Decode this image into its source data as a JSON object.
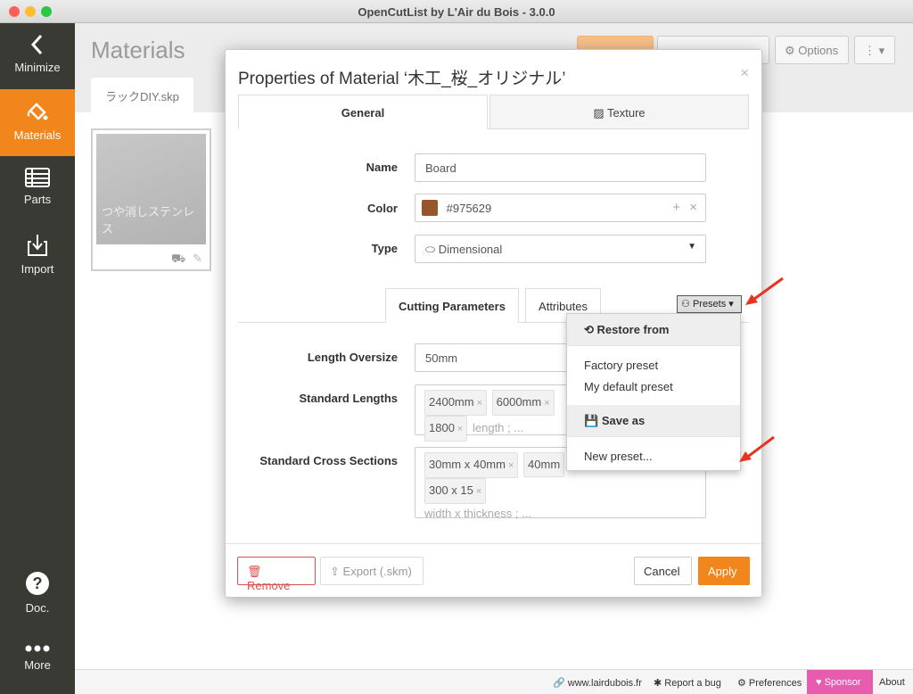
{
  "window": {
    "title": "OpenCutList by L'Air du Bois - 3.0.0"
  },
  "sidebar": {
    "items": [
      {
        "label": "Minimize",
        "icon": "chevron-left-icon"
      },
      {
        "label": "Materials",
        "icon": "paint-bucket-icon"
      },
      {
        "label": "Parts",
        "icon": "list-icon"
      },
      {
        "label": "Import",
        "icon": "import-icon"
      },
      {
        "label": "Doc.",
        "icon": "help-icon"
      },
      {
        "label": "More",
        "icon": "more-icon"
      }
    ]
  },
  "main": {
    "title": "Materials",
    "file_tab": "ラックDIY.skp",
    "options_label": "Options",
    "material_card": {
      "name": "つや消しステンレス"
    }
  },
  "dialog": {
    "title": "Properties of Material ‘木工_桜_オリジナル’",
    "close": "×",
    "tabs": [
      {
        "label": "General"
      },
      {
        "label": "Texture"
      }
    ],
    "fields": {
      "name_label": "Name",
      "name_value": "Board",
      "color_label": "Color",
      "color_value": "#975629",
      "type_label": "Type",
      "type_value": "Dimensional"
    },
    "sub_tabs": [
      {
        "label": "Cutting Parameters"
      },
      {
        "label": "Attributes"
      }
    ],
    "presets_label": "Presets",
    "length_oversize_label": "Length Oversize",
    "length_oversize_value": "50mm",
    "standard_lengths_label": "Standard Lengths",
    "standard_lengths": [
      "2400mm",
      "6000mm",
      "1800"
    ],
    "standard_lengths_placeholder": "length ; ...",
    "cross_sections_label": "Standard Cross Sections",
    "cross_sections": [
      "30mm x 40mm",
      "40mm",
      "300 x 15"
    ],
    "cross_sections_placeholder": "width x thickness ; ...",
    "buttons": {
      "remove": "Remove",
      "export": "Export (.skm)",
      "cancel": "Cancel",
      "apply": "Apply"
    }
  },
  "presets_menu": {
    "restore_header": "Restore from",
    "factory": "Factory preset",
    "my_default": "My default preset",
    "save_header": "Save as",
    "new_preset": "New preset..."
  },
  "footer": {
    "site": "www.lairdubois.fr",
    "bug": "Report a bug",
    "preferences": "Preferences",
    "sponsor": "Sponsor",
    "about": "About"
  },
  "colors": {
    "accent": "#f0861c",
    "sidebar": "#3a3a34",
    "sponsor": "#e85cb0",
    "remove": "#d9534f",
    "arrow": "#e8341c"
  }
}
